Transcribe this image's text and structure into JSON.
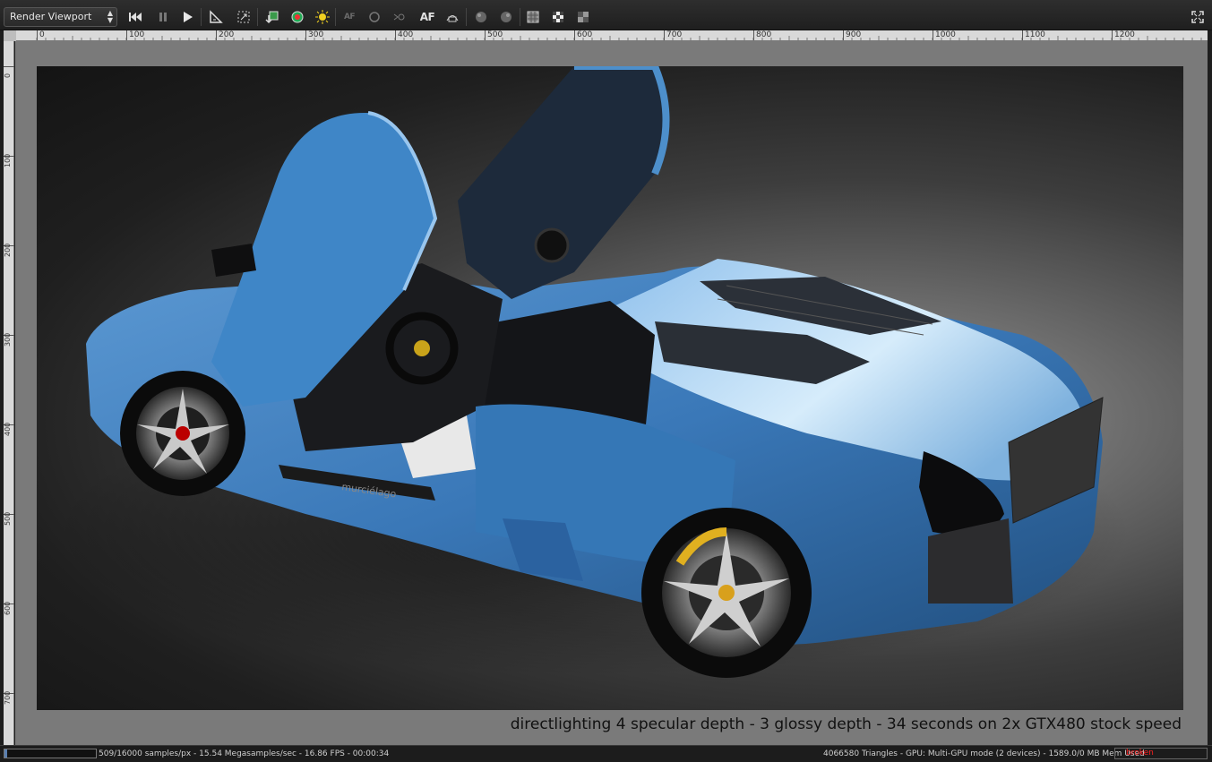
{
  "toolbar": {
    "viewport_select": "Render Viewport",
    "af_label": "AF",
    "af_small_label": "AF"
  },
  "ruler": {
    "horizontal_ticks": [
      "0",
      "100",
      "200",
      "300",
      "400",
      "500",
      "600",
      "700",
      "800",
      "900",
      "1000",
      "1100",
      "1200"
    ],
    "vertical_ticks": [
      "0",
      "100",
      "200",
      "300",
      "400",
      "500",
      "600",
      "700"
    ]
  },
  "render": {
    "caption": "directlighting 4 specular depth - 3 glossy depth - 34 seconds on 2x GTX480 stock speed",
    "car_text": "murciélago"
  },
  "status": {
    "progress": 0.03,
    "left_text": "509/16000 samples/px - 15.54 Megasamples/sec - 16.86 FPS - 00:00:34",
    "right_text": "4066580 Triangles - GPU: Multi-GPU mode (2 devices) - 1589.0/0 MB Mem Used",
    "error_text": "broken"
  },
  "colors": {
    "car_blue": "#3a78b8",
    "accent_error": "#ff2020"
  }
}
